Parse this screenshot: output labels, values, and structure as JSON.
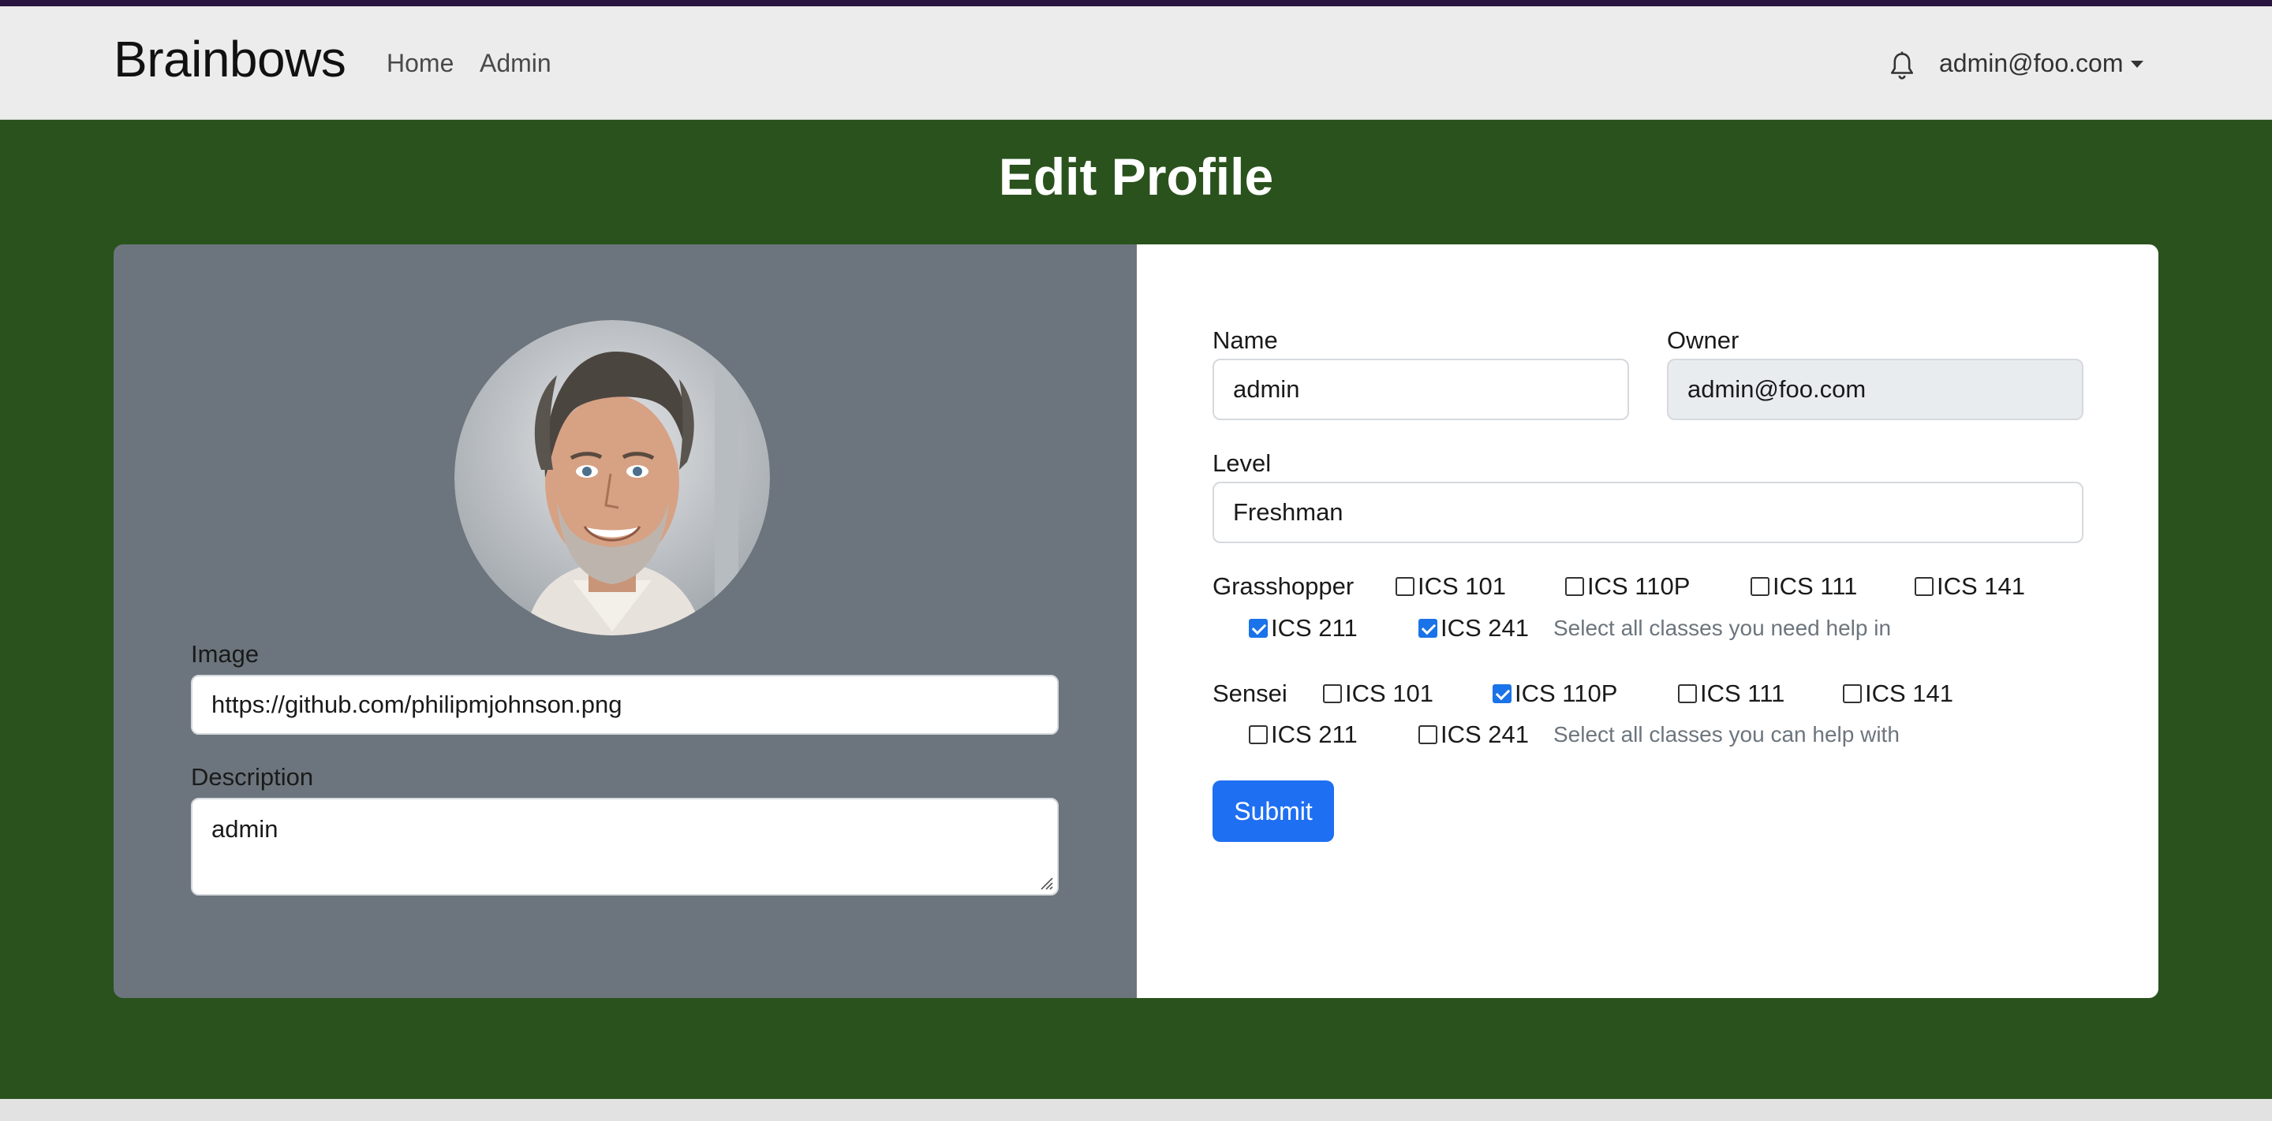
{
  "navbar": {
    "brand": "Brainbows",
    "links": [
      "Home",
      "Admin"
    ],
    "user": "admin@foo.com"
  },
  "page": {
    "title": "Edit Profile"
  },
  "form": {
    "image_label": "Image",
    "image_value": "https://github.com/philipmjohnson.png",
    "description_label": "Description",
    "description_value": "admin",
    "name_label": "Name",
    "name_value": "admin",
    "owner_label": "Owner",
    "owner_value": "admin@foo.com",
    "level_label": "Level",
    "level_value": "Freshman",
    "grasshopper": {
      "label": "Grasshopper",
      "options": [
        {
          "label": "ICS 101",
          "checked": false
        },
        {
          "label": "ICS 110P",
          "checked": false
        },
        {
          "label": "ICS 111",
          "checked": false
        },
        {
          "label": "ICS 141",
          "checked": false
        },
        {
          "label": "ICS 211",
          "checked": true
        },
        {
          "label": "ICS 241",
          "checked": true
        }
      ],
      "help": "Select all classes you need help in"
    },
    "sensei": {
      "label": "Sensei",
      "options": [
        {
          "label": "ICS 101",
          "checked": false
        },
        {
          "label": "ICS 110P",
          "checked": true
        },
        {
          "label": "ICS 111",
          "checked": false
        },
        {
          "label": "ICS 141",
          "checked": false
        },
        {
          "label": "ICS 211",
          "checked": false
        },
        {
          "label": "ICS 241",
          "checked": false
        }
      ],
      "help": "Select all classes you can help with"
    },
    "submit_label": "Submit"
  },
  "colors": {
    "accent": "#1f6ff2",
    "page_bg": "#2a521d",
    "left_pane": "#6c757d"
  }
}
